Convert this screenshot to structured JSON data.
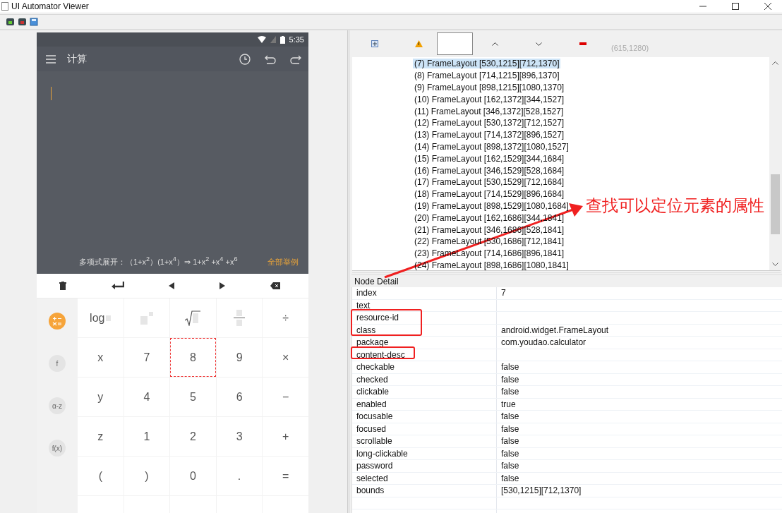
{
  "window": {
    "title": "UI Automator Viewer"
  },
  "device": {
    "status_time": "5:35",
    "app_title": "计算",
    "formula_hint": "多项式展开：（1+x$^{2}$）(1+x$^{4}$）⇒ 1+x$^{2}$ +x$^{4}$ +x$^{6}$",
    "examples_link": "全部举例",
    "modes": [
      {
        "kind": "icon",
        "selected": true
      },
      {
        "kind": "text",
        "label": "f",
        "selected": false
      },
      {
        "kind": "text",
        "label": "α-z",
        "selected": false
      },
      {
        "kind": "text",
        "label": "f(x)",
        "selected": false
      }
    ],
    "key_rows": [
      [
        {
          "kind": "log",
          "label": "log",
          "selected": false
        },
        {
          "kind": "power",
          "selected": false
        },
        {
          "kind": "root",
          "selected": false
        },
        {
          "kind": "fraction",
          "selected": false
        },
        {
          "kind": "text",
          "label": "÷",
          "selected": false
        }
      ],
      [
        {
          "kind": "text",
          "label": "x",
          "selected": false
        },
        {
          "kind": "text",
          "label": "7",
          "selected": false
        },
        {
          "kind": "text",
          "label": "8",
          "selected": true
        },
        {
          "kind": "text",
          "label": "9",
          "selected": false
        },
        {
          "kind": "text",
          "label": "×",
          "selected": false
        }
      ],
      [
        {
          "kind": "text",
          "label": "y",
          "selected": false
        },
        {
          "kind": "text",
          "label": "4",
          "selected": false
        },
        {
          "kind": "text",
          "label": "5",
          "selected": false
        },
        {
          "kind": "text",
          "label": "6",
          "selected": false
        },
        {
          "kind": "text",
          "label": "−",
          "selected": false
        }
      ],
      [
        {
          "kind": "text",
          "label": "z",
          "selected": false
        },
        {
          "kind": "text",
          "label": "1",
          "selected": false
        },
        {
          "kind": "text",
          "label": "2",
          "selected": false
        },
        {
          "kind": "text",
          "label": "3",
          "selected": false
        },
        {
          "kind": "text",
          "label": "+",
          "selected": false
        }
      ],
      [
        {
          "kind": "text",
          "label": "(",
          "selected": false
        },
        {
          "kind": "text",
          "label": ")",
          "selected": false
        },
        {
          "kind": "text",
          "label": "0",
          "selected": false
        },
        {
          "kind": "text",
          "label": ".",
          "selected": false
        },
        {
          "kind": "text",
          "label": "=",
          "selected": false
        }
      ],
      [
        {
          "kind": "blank",
          "selected": false
        },
        {
          "kind": "blank",
          "selected": false
        },
        {
          "kind": "blank",
          "selected": false
        },
        {
          "kind": "blank",
          "selected": false
        },
        {
          "kind": "blank",
          "selected": false
        }
      ]
    ]
  },
  "toolbar": {
    "coordinates": "(615,1280)"
  },
  "tree": [
    {
      "label": "(7) FrameLayout [530,1215][712,1370]",
      "selected": true
    },
    {
      "label": "(8) FrameLayout [714,1215][896,1370]",
      "selected": false
    },
    {
      "label": "(9) FrameLayout [898,1215][1080,1370]",
      "selected": false
    },
    {
      "label": "(10) FrameLayout [162,1372][344,1527]",
      "selected": false
    },
    {
      "label": "(11) FrameLayout [346,1372][528,1527]",
      "selected": false
    },
    {
      "label": "(12) FrameLayout [530,1372][712,1527]",
      "selected": false
    },
    {
      "label": "(13) FrameLayout [714,1372][896,1527]",
      "selected": false
    },
    {
      "label": "(14) FrameLayout [898,1372][1080,1527]",
      "selected": false
    },
    {
      "label": "(15) FrameLayout [162,1529][344,1684]",
      "selected": false
    },
    {
      "label": "(16) FrameLayout [346,1529][528,1684]",
      "selected": false
    },
    {
      "label": "(17) FrameLayout [530,1529][712,1684]",
      "selected": false
    },
    {
      "label": "(18) FrameLayout [714,1529][896,1684]",
      "selected": false
    },
    {
      "label": "(19) FrameLayout [898,1529][1080,1684]",
      "selected": false
    },
    {
      "label": "(20) FrameLayout [162,1686][344,1841]",
      "selected": false
    },
    {
      "label": "(21) FrameLayout [346,1686][528,1841]",
      "selected": false
    },
    {
      "label": "(22) FrameLayout [530,1686][712,1841]",
      "selected": false
    },
    {
      "label": "(23) FrameLayout [714,1686][896,1841]",
      "selected": false
    },
    {
      "label": "(24) FrameLayout [898,1686][1080,1841]",
      "selected": false
    }
  ],
  "node_detail": {
    "title": "Node Detail",
    "rows": [
      {
        "key": "index",
        "value": "7"
      },
      {
        "key": "text"
      },
      {
        "key": "resource-id"
      },
      {
        "key": "class",
        "value": "android.widget.FrameLayout"
      },
      {
        "key": "package",
        "value": "com.youdao.calculator"
      },
      {
        "key": "content-desc"
      },
      {
        "key": "checkable",
        "value": "false"
      },
      {
        "key": "checked",
        "value": "false"
      },
      {
        "key": "clickable",
        "value": "false"
      },
      {
        "key": "enabled",
        "value": "true"
      },
      {
        "key": "focusable",
        "value": "false"
      },
      {
        "key": "focused",
        "value": "false"
      },
      {
        "key": "scrollable",
        "value": "false"
      },
      {
        "key": "long-clickable",
        "value": "false"
      },
      {
        "key": "password",
        "value": "false"
      },
      {
        "key": "selected",
        "value": "false"
      },
      {
        "key": "bounds",
        "value": "[530,1215][712,1370]"
      }
    ]
  },
  "annotation": {
    "text": "查找可以定位元素的属性"
  }
}
